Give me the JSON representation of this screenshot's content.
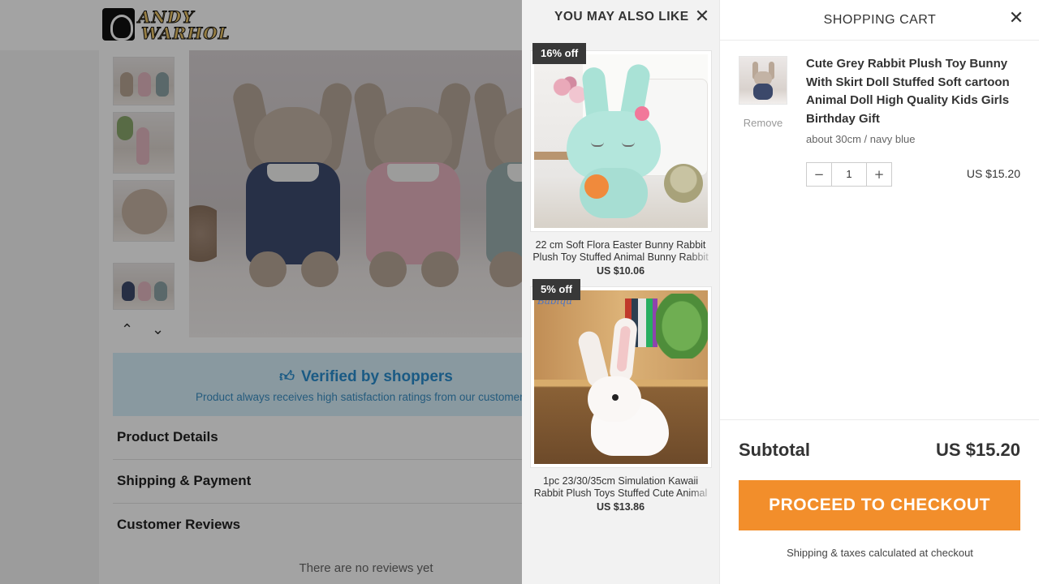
{
  "store": {
    "logo_line1": "ANDY",
    "logo_line2": "WARHOL"
  },
  "product_page": {
    "verified_title": "Verified by shoppers",
    "verified_subtitle": "Product always receives high satisfaction ratings from our customers",
    "sections": [
      "Product Details",
      "Shipping & Payment",
      "Customer Reviews"
    ],
    "reviews_empty": "There are no reviews yet",
    "thumb_up_arrow": "chevron-up-icon",
    "thumb_down_arrow": "chevron-down-icon"
  },
  "recommendations": {
    "title": "YOU MAY ALSO LIKE",
    "close_icon": "close-icon",
    "items": [
      {
        "badge": "16% off",
        "name_line1": "22 cm Soft Flora Easter Bunny Rabbit",
        "name_line2": "Plush Toy Stuffed Animal Bunny Rabbit",
        "price": "US $10.06"
      },
      {
        "badge": "5% off",
        "name_line1": "1pc 23/30/35cm Simulation Kawaii",
        "name_line2": "Rabbit Plush Toys Stuffed Cute Animal",
        "price": "US $13.86",
        "image_brand_text": "Babiqu"
      }
    ]
  },
  "cart": {
    "title": "SHOPPING CART",
    "close_icon": "close-icon",
    "item": {
      "name": "Cute Grey Rabbit Plush Toy Bunny With Skirt Doll Stuffed Soft cartoon Animal Doll High Quality Kids Girls Birthday Gift",
      "variant": "about 30cm / navy blue",
      "remove_label": "Remove",
      "quantity": "1",
      "minus_label": "−",
      "plus_label": "+",
      "price": "US $15.20"
    },
    "subtotal_label": "Subtotal",
    "subtotal_value": "US $15.20",
    "checkout_label": "PROCEED TO CHECKOUT",
    "shipping_note": "Shipping & taxes calculated at checkout"
  },
  "colors": {
    "checkout_button": "#f28e2b",
    "verified_text": "#2a8ecf",
    "verified_bg": "#d7f0fb",
    "badge_bg": "#383838",
    "overlay": "rgba(0,0,0,0.36)"
  }
}
